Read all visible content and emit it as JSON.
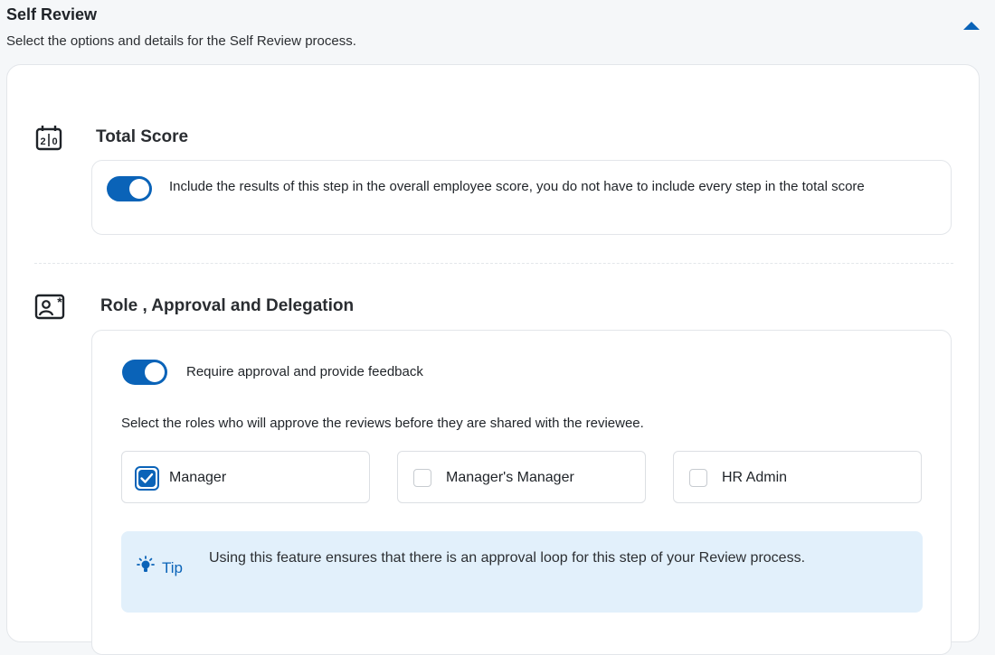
{
  "header": {
    "title": "Self Review",
    "subtitle": "Select the options and details for the Self Review process."
  },
  "total_score": {
    "title": "Total Score",
    "icon": "scoreboard-icon",
    "toggle_on": true,
    "description": "Include the results of this step in the overall employee score, you do not have to include every step in the total score"
  },
  "role_approval": {
    "title": "Role , Approval and Delegation",
    "icon": "contact-card-icon",
    "toggle_on": true,
    "toggle_label": "Require approval and provide feedback",
    "instructions": "Select the roles who will approve the reviews before they are shared with the reviewee.",
    "roles": [
      {
        "label": "Manager",
        "checked": true
      },
      {
        "label": "Manager's Manager",
        "checked": false
      },
      {
        "label": "HR Admin",
        "checked": false
      }
    ],
    "tip": {
      "label": "Tip",
      "icon": "lightbulb-icon",
      "text": "Using this feature ensures that there is an approval loop for this step of your Review process."
    }
  },
  "colors": {
    "accent": "#0a63b8",
    "tip_bg": "#e2f0fb",
    "border": "#e3e6ea"
  }
}
